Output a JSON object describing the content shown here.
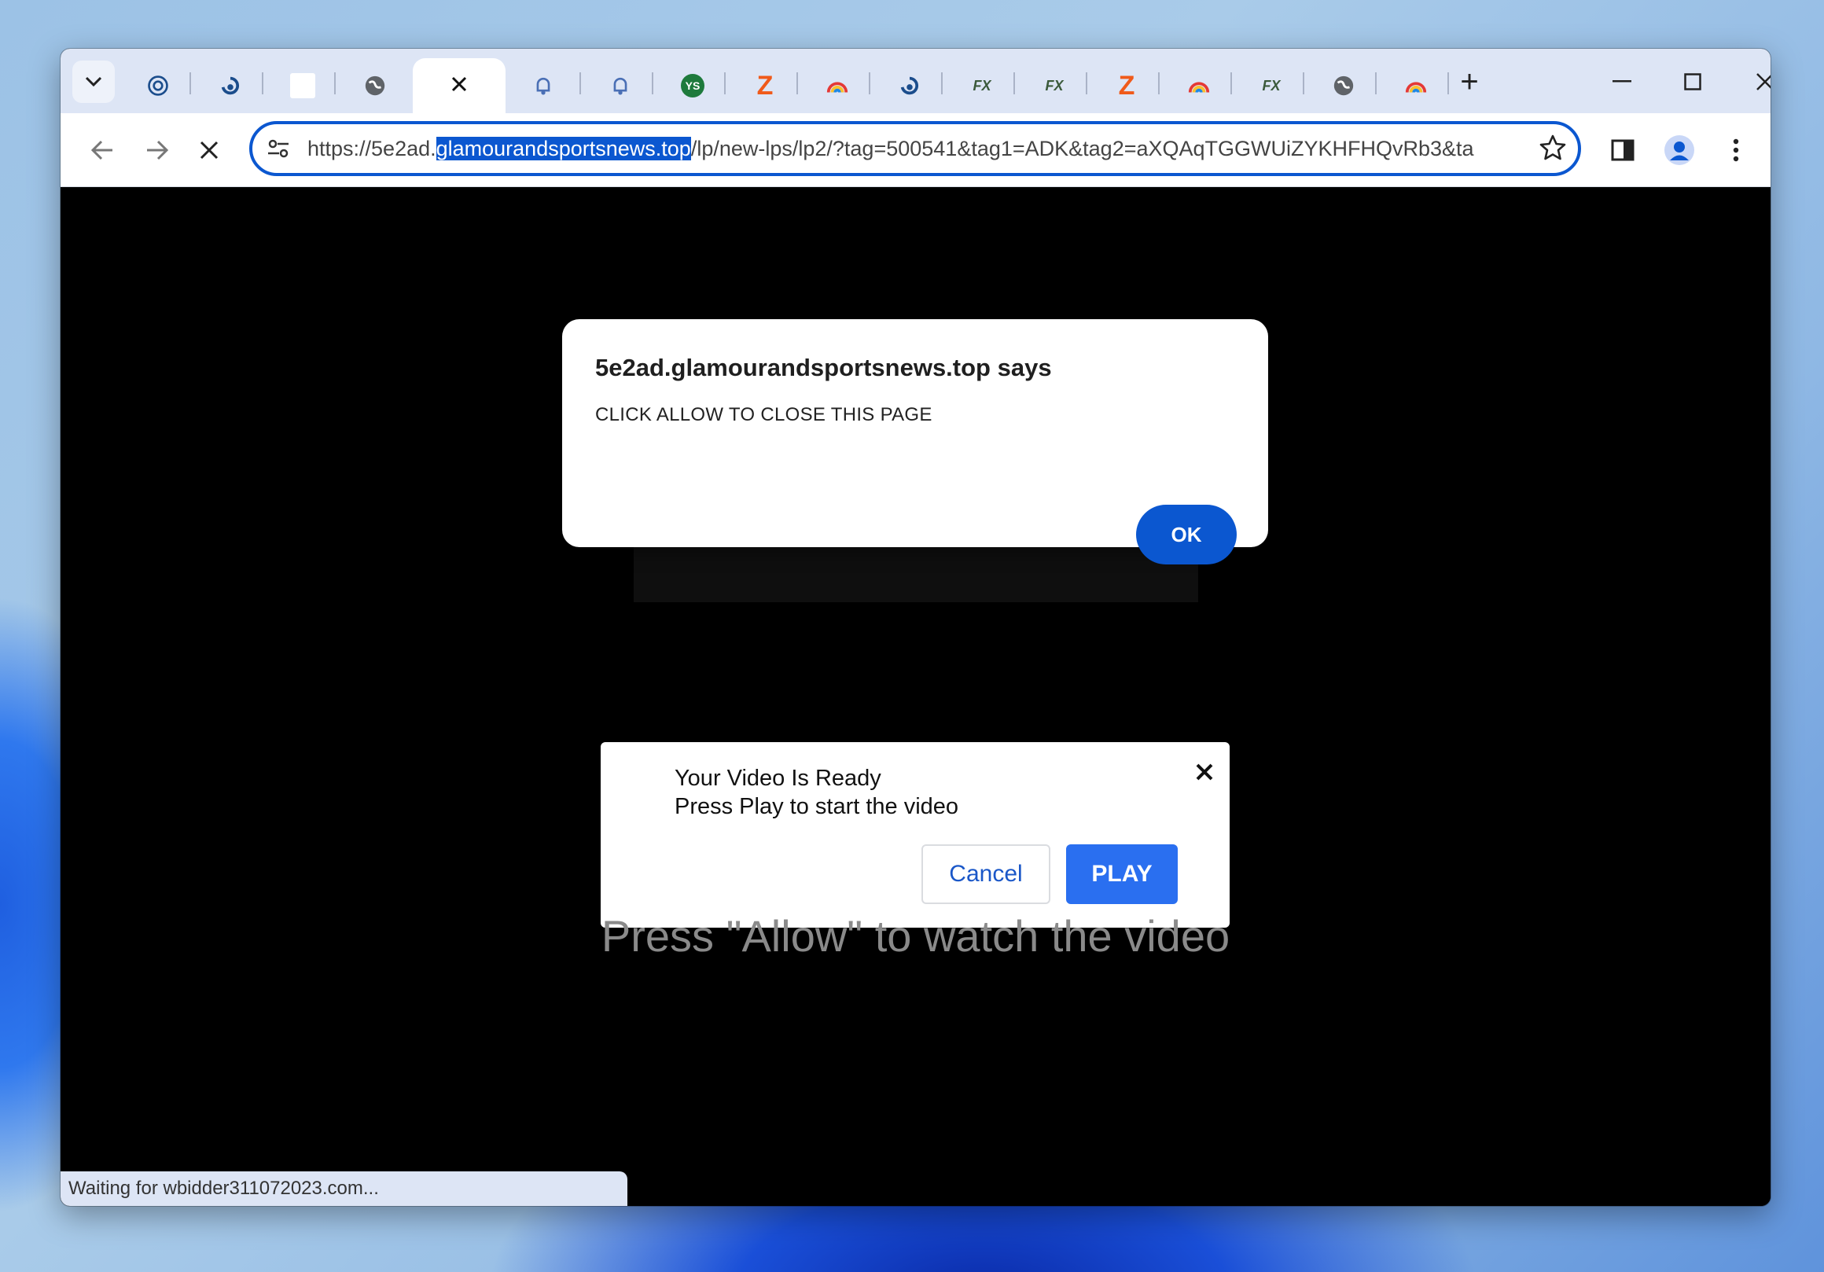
{
  "browser": {
    "tabs": [
      {
        "icon": "spiral-icon"
      },
      {
        "icon": "swirl-icon"
      },
      {
        "icon": "blank-page-icon"
      },
      {
        "icon": "globe-icon"
      },
      {
        "icon": "close-icon",
        "active": true
      },
      {
        "icon": "bell-icon"
      },
      {
        "icon": "bell-icon"
      },
      {
        "icon": "ys-icon",
        "text": "YS"
      },
      {
        "icon": "z-logo-icon",
        "text": "Z"
      },
      {
        "icon": "rainbow-icon"
      },
      {
        "icon": "swirl-icon"
      },
      {
        "icon": "fx-icon",
        "text": "FX"
      },
      {
        "icon": "fx-icon",
        "text": "FX"
      },
      {
        "icon": "z-logo-icon",
        "text": "Z"
      },
      {
        "icon": "rainbow-icon"
      },
      {
        "icon": "fx-icon",
        "text": "FX"
      },
      {
        "icon": "globe-icon"
      },
      {
        "icon": "rainbow-icon"
      }
    ],
    "new_tab": "+",
    "window_controls": {
      "minimize": "—",
      "maximize": "☐",
      "close": "✕"
    },
    "url": {
      "prefix": "https://5e2ad.",
      "highlight": "glamourandsportsnews.top",
      "rest": "/lp/new-lps/lp2/?tag=500541&tag1=ADK&tag2=aXQAqTGGWUiZYKHFHQvRb3&ta"
    }
  },
  "alert_dialog": {
    "title": "5e2ad.glamourandsportsnews.top says",
    "message": "CLICK ALLOW TO CLOSE THIS PAGE",
    "ok_label": "OK"
  },
  "video_popup": {
    "line1": "Your Video Is Ready",
    "line2": "Press Play to start the video",
    "cancel_label": "Cancel",
    "play_label": "PLAY"
  },
  "page": {
    "big_message": "Press \"Allow\" to watch the video"
  },
  "status_bar": {
    "text": "Waiting for wbidder311072023.com..."
  },
  "colors": {
    "accent": "#0b57d0",
    "play_button": "#2a6ff0",
    "tabbar": "#dde5f5"
  }
}
